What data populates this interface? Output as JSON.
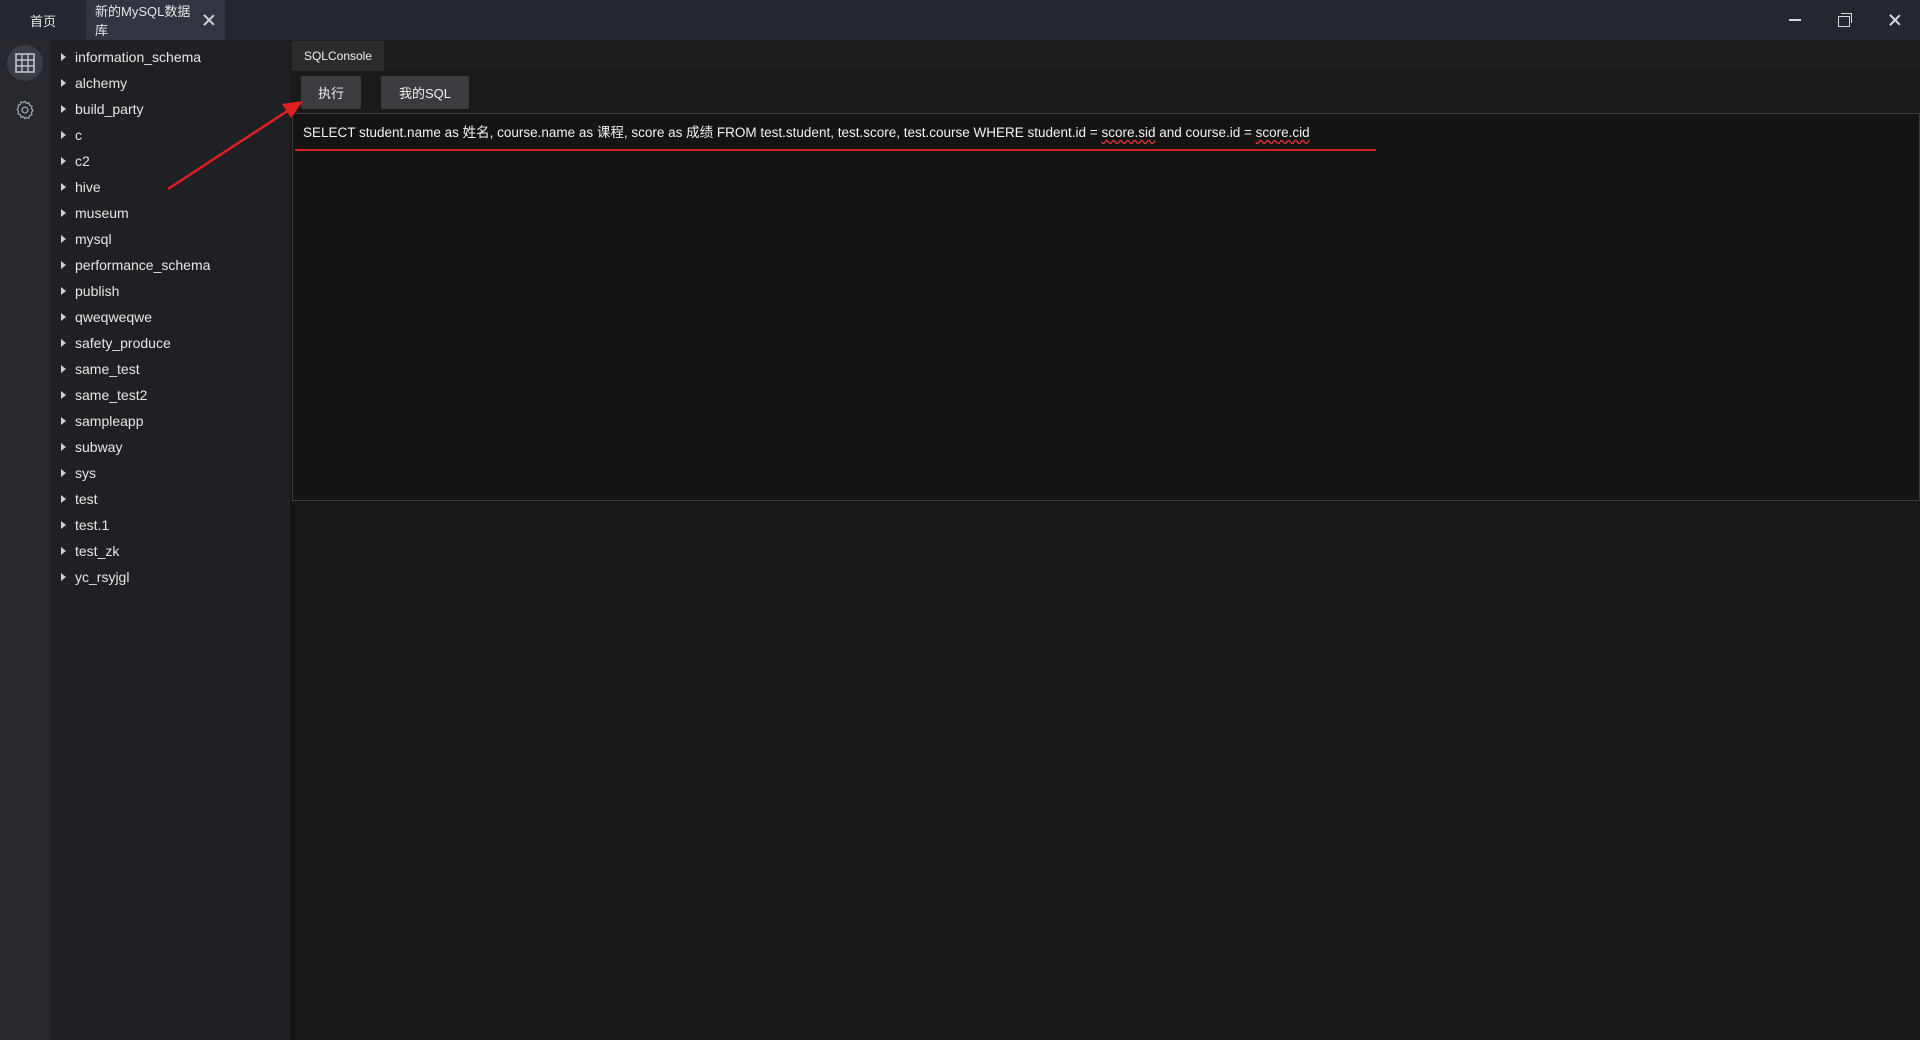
{
  "titlebar": {
    "home_tab": "首页",
    "active_tab": "新的MySQL数据库"
  },
  "rail": {
    "icons": [
      "database-icon",
      "settings-icon"
    ]
  },
  "tree": {
    "items": [
      {
        "label": "information_schema"
      },
      {
        "label": "alchemy"
      },
      {
        "label": "build_party"
      },
      {
        "label": "c"
      },
      {
        "label": "c2"
      },
      {
        "label": "hive"
      },
      {
        "label": "museum"
      },
      {
        "label": "mysql"
      },
      {
        "label": "performance_schema"
      },
      {
        "label": "publish"
      },
      {
        "label": "qweqweqwe"
      },
      {
        "label": "safety_produce"
      },
      {
        "label": "same_test"
      },
      {
        "label": "same_test2"
      },
      {
        "label": "sampleapp"
      },
      {
        "label": "subway"
      },
      {
        "label": "sys"
      },
      {
        "label": "test"
      },
      {
        "label": "test.1"
      },
      {
        "label": "test_zk"
      },
      {
        "label": "yc_rsyjgl"
      }
    ]
  },
  "console": {
    "tab_label": "SQLConsole",
    "run_button": "执行",
    "my_sql_button": "我的SQL",
    "sql_part1": "SELECT student.name as 姓名, course.name as 课程, score as 成绩 FROM test.student, test.score, test.course WHERE student.id = ",
    "sql_part2": "score.sid",
    "sql_part3": " and course.id = ",
    "sql_part4": "score.cid"
  },
  "colors": {
    "accent_red": "#d21e1e",
    "titlebar_bg": "#242730",
    "tree_bg": "#1f2024"
  }
}
